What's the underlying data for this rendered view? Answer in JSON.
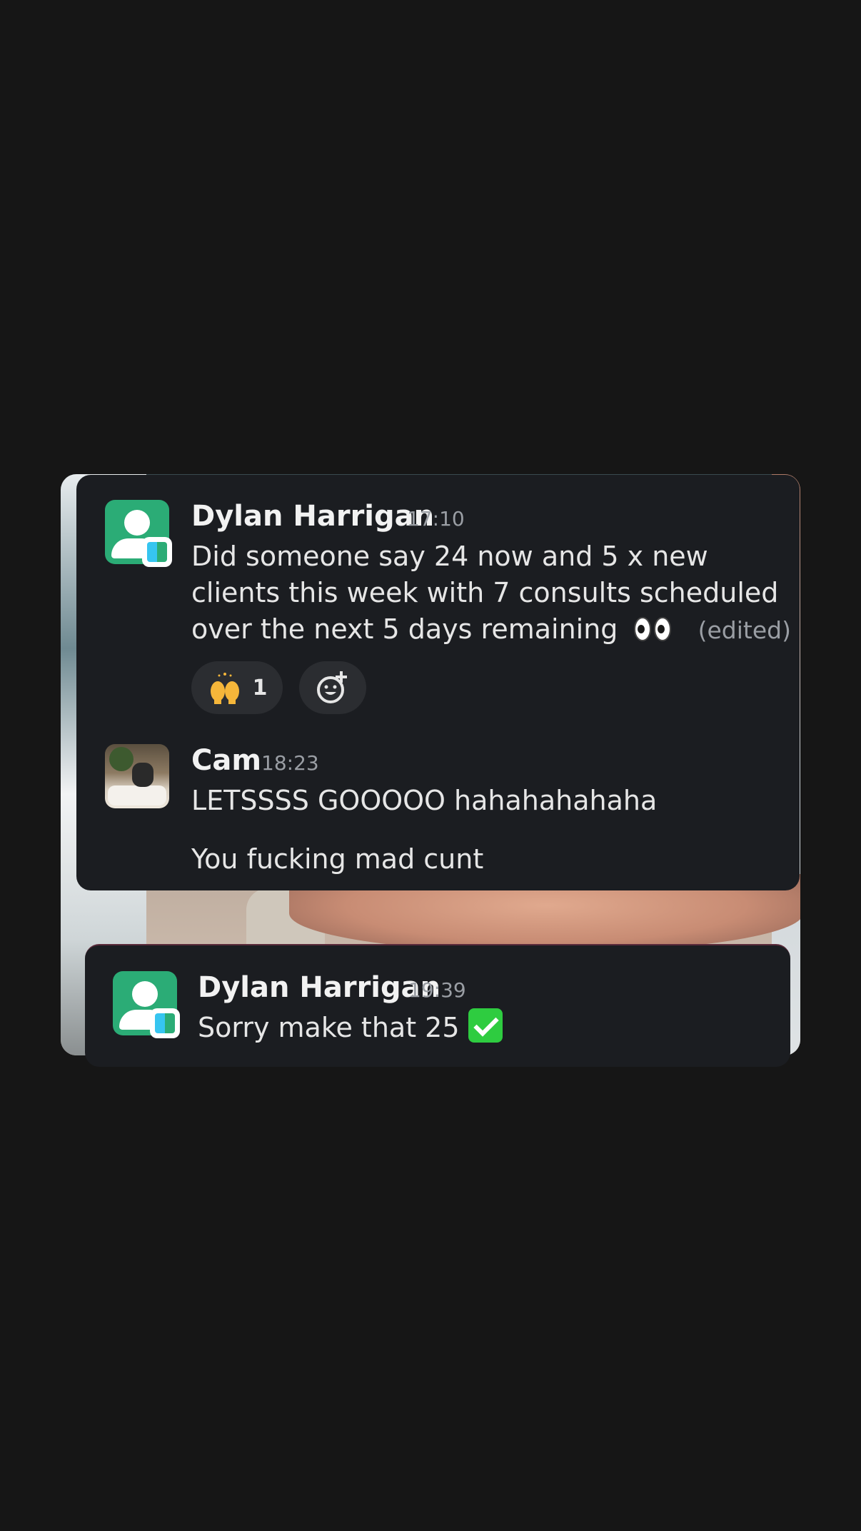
{
  "messages": [
    {
      "author": "Dylan Harrigan",
      "time": "17:10",
      "lines": [
        "Did someone say 24 now and 5 x new",
        "clients this week with 7 consults scheduled",
        "over the next 5 days remaining"
      ],
      "emoji": "eyes",
      "edited_label": "(edited)",
      "reactions": [
        {
          "emoji": "raising-hands",
          "count": "1"
        }
      ],
      "avatar_icon": "user-avatar-icon"
    },
    {
      "author": "Cam",
      "time": "18:23",
      "lines": [
        "LETSSSS GOOOOO hahahahahaha"
      ],
      "second_line": "You fucking mad cunt",
      "avatar_icon": "photo-avatar"
    },
    {
      "author": "Dylan Harrigan",
      "time": "19:39",
      "lines": [
        "Sorry make that 25"
      ],
      "emoji": "check-mark",
      "avatar_icon": "user-avatar-icon"
    }
  ],
  "colors": {
    "background": "#161616",
    "card": "#1b1d21",
    "avatar_green": "#2bac76",
    "check_green": "#2ecc40",
    "muted": "#9a9ea4"
  }
}
